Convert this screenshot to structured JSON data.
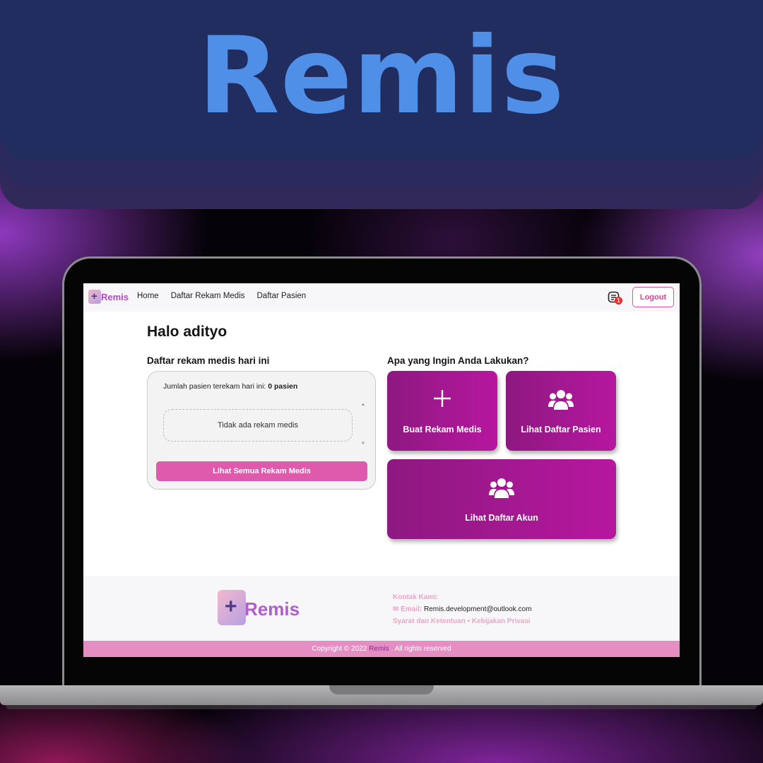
{
  "banner": {
    "title": "Remis"
  },
  "app": {
    "logo_text": "Remis",
    "nav": {
      "links": [
        "Home",
        "Daftar Rekam Medis",
        "Daftar Pasien"
      ],
      "notification_count": "1",
      "logout_label": "Logout"
    },
    "main": {
      "greeting": "Halo adityo",
      "records": {
        "title": "Daftar rekam medis hari ini",
        "count_prefix": "Jumlah pasien terekam hari ini:",
        "count_value": "0 pasien",
        "empty_text": "Tidak ada rekam medis",
        "view_all_label": "Lihat Semua Rekam Medis"
      },
      "actions": {
        "title": "Apa yang Ingin Anda Lakukan?",
        "items": [
          {
            "label": "Buat Rekam Medis",
            "icon": "plus-icon"
          },
          {
            "label": "Lihat Daftar Pasien",
            "icon": "users-icon"
          },
          {
            "label": "Lihat Daftar Akun",
            "icon": "users-icon"
          }
        ]
      }
    },
    "footer": {
      "logo_text": "Remis",
      "contact_title": "Kontak Kami:",
      "email_label": "Email:",
      "email_value": "Remis.development@outlook.com",
      "terms": "Syarat dan Ketentuan",
      "separator": "•",
      "privacy": "Kebijakan Privasi",
      "copyright_prefix": "Copyright © 2022",
      "copyright_brand": "Remis",
      "copyright_suffix": ". All rights reserved"
    }
  },
  "colors": {
    "banner_bg": "#212c5f",
    "banner_title": "#4f8fe8",
    "accent_pink": "#df5aad",
    "action_card": "#a3188f",
    "footer_bar": "#e68dc4"
  }
}
